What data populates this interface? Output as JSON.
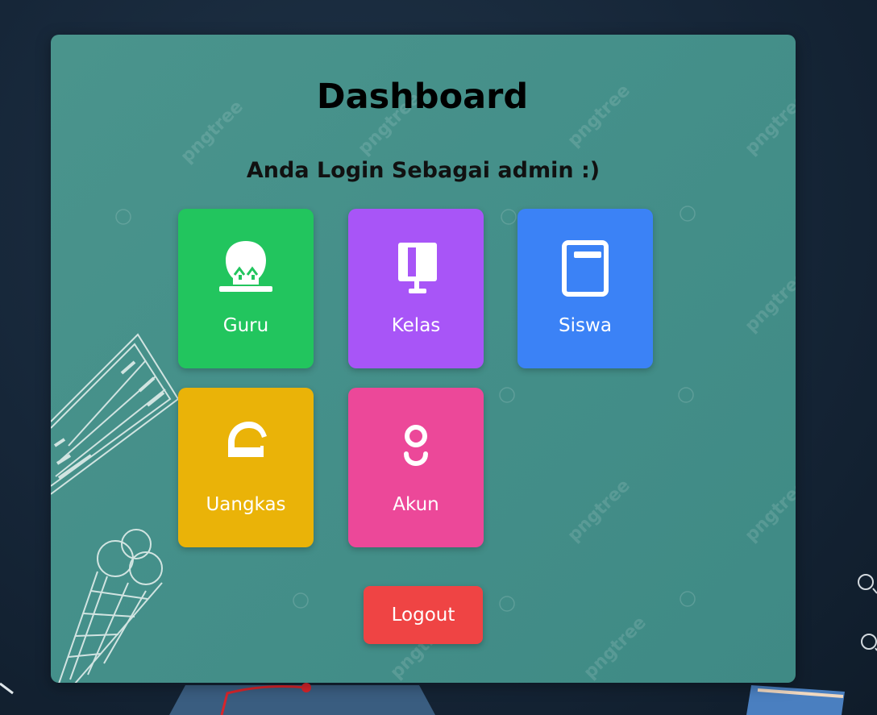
{
  "page": {
    "title": "Dashboard",
    "subtitle": "Anda Login Sebagai admin :)"
  },
  "menu": [
    {
      "label": "Guru",
      "icon": "teacher-icon",
      "color": "#22c55e"
    },
    {
      "label": "Kelas",
      "icon": "classroom-board-icon",
      "color": "#a855f7"
    },
    {
      "label": "Siswa",
      "icon": "book-icon",
      "color": "#3b82f6"
    },
    {
      "label": "Uangkas",
      "icon": "cash-icon",
      "color": "#eab308"
    },
    {
      "label": "Akun",
      "icon": "user-account-icon",
      "color": "#ec4899"
    }
  ],
  "logout": {
    "label": "Logout",
    "color": "#ef4444"
  },
  "watermark": "pngtree"
}
